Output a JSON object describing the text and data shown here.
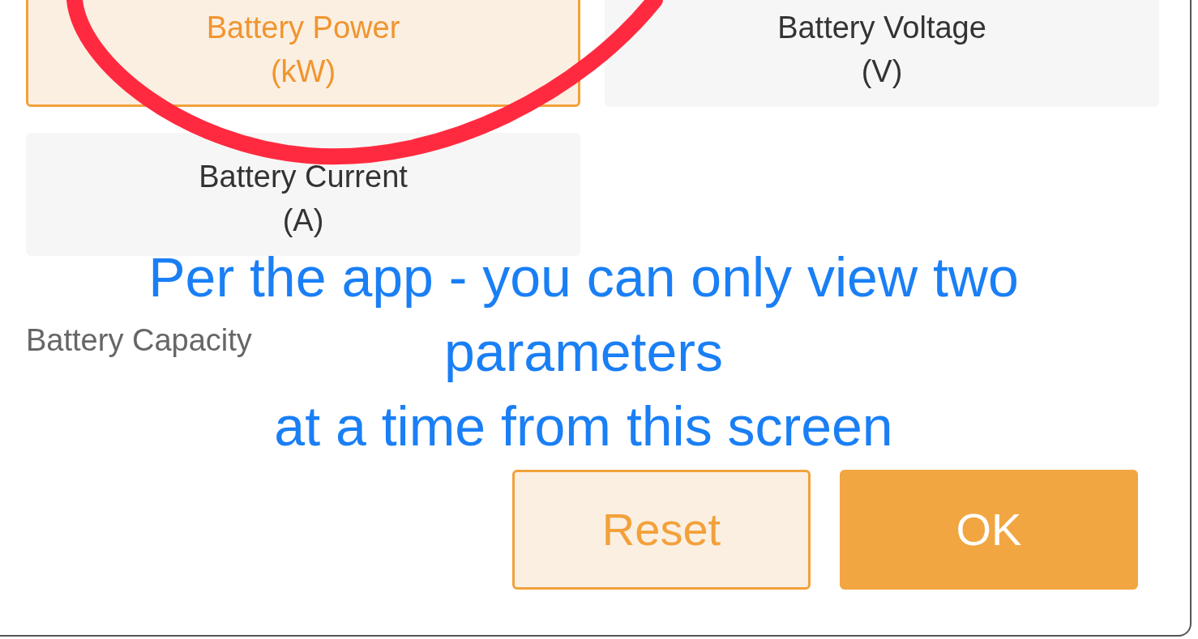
{
  "parameters": [
    {
      "name": "Battery Power",
      "unit": "(kW)",
      "selected": true
    },
    {
      "name": "Battery Voltage",
      "unit": "(V)",
      "selected": false
    },
    {
      "name": "Battery Current",
      "unit": "(A)",
      "selected": false
    }
  ],
  "section_label": "Battery Capacity",
  "buttons": [
    {
      "label": "Reset",
      "kind": "outline"
    },
    {
      "label": "OK",
      "kind": "filled"
    }
  ],
  "annotation": {
    "lines": [
      "Per the app - you can only view two",
      "parameters",
      "at a time from this screen"
    ]
  }
}
